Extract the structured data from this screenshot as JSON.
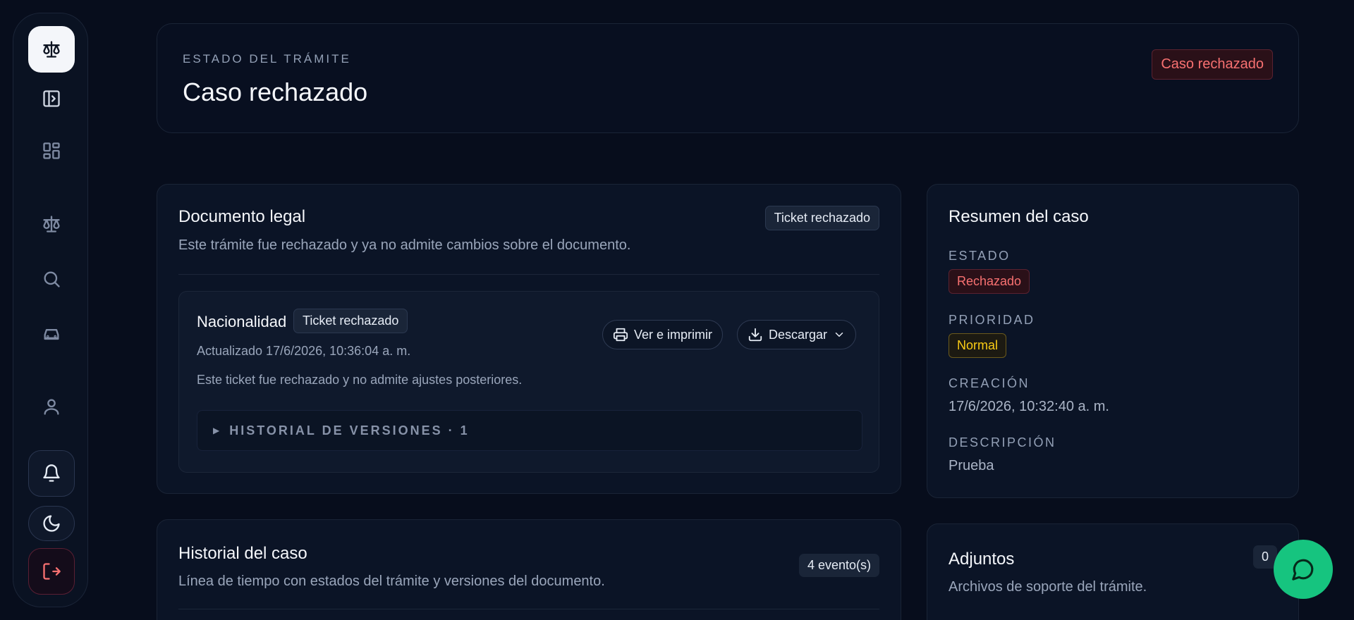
{
  "sidebar": {
    "items": [
      {
        "icon": "scales-icon"
      },
      {
        "icon": "panel-expand-icon"
      },
      {
        "icon": "dashboard-grid-icon"
      },
      {
        "icon": "scales-icon"
      },
      {
        "icon": "search-icon"
      },
      {
        "icon": "car-icon"
      },
      {
        "icon": "user-icon"
      },
      {
        "icon": "bell-icon"
      },
      {
        "icon": "moon-icon"
      },
      {
        "icon": "logout-icon"
      }
    ]
  },
  "header": {
    "eyebrow": "ESTADO DEL TRÁMITE",
    "title": "Caso rechazado",
    "status_badge": "Caso rechazado"
  },
  "document": {
    "title": "Documento legal",
    "badge": "Ticket rechazado",
    "subtitle": "Este trámite fue rechazado y ya no admite cambios sobre el documento.",
    "ticket": {
      "title": "Nacionalidad",
      "badge": "Ticket rechazado",
      "updated": "Actualizado 17/6/2026, 10:36:04 a. m.",
      "note": "Este ticket fue rechazado y no admite ajustes posteriores.",
      "print_label": "Ver e imprimir",
      "download_label": "Descargar",
      "versions": "HISTORIAL DE VERSIONES · 1"
    }
  },
  "summary": {
    "title": "Resumen del caso",
    "estado_label": "ESTADO",
    "estado_value": "Rechazado",
    "prioridad_label": "PRIORIDAD",
    "prioridad_value": "Normal",
    "creacion_label": "CREACIÓN",
    "creacion_value": "17/6/2026, 10:32:40 a. m.",
    "descripcion_label": "DESCRIPCIÓN",
    "descripcion_value": "Prueba"
  },
  "history": {
    "title": "Historial del caso",
    "subtitle": "Línea de tiempo con estados del trámite y versiones del documento.",
    "count": "4 evento(s)"
  },
  "attachments": {
    "title": "Adjuntos",
    "subtitle": "Archivos de soporte del trámite.",
    "count": "0"
  },
  "colors": {
    "background": "#070d1c",
    "danger": "#f87171",
    "warning": "#facc15",
    "chat_button": "#16c47f"
  }
}
